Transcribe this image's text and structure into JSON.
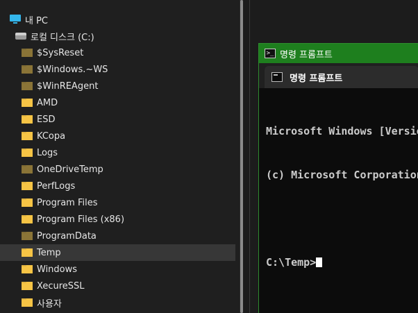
{
  "explorer": {
    "this_pc": "내 PC",
    "drive": "로컬 디스크 (C:)",
    "folders": [
      {
        "label": "$SysReset",
        "style": "dim"
      },
      {
        "label": "$Windows.~WS",
        "style": "dim"
      },
      {
        "label": "$WinREAgent",
        "style": "dim"
      },
      {
        "label": "AMD",
        "style": "normal"
      },
      {
        "label": "ESD",
        "style": "normal"
      },
      {
        "label": "KCopa",
        "style": "normal"
      },
      {
        "label": "Logs",
        "style": "normal"
      },
      {
        "label": "OneDriveTemp",
        "style": "dim"
      },
      {
        "label": "PerfLogs",
        "style": "normal"
      },
      {
        "label": "Program Files",
        "style": "normal"
      },
      {
        "label": "Program Files (x86)",
        "style": "normal"
      },
      {
        "label": "ProgramData",
        "style": "dim"
      },
      {
        "label": "Temp",
        "style": "normal",
        "selected": true
      },
      {
        "label": "Windows",
        "style": "normal"
      },
      {
        "label": "XecureSSL",
        "style": "normal"
      },
      {
        "label": "사용자",
        "style": "normal"
      }
    ]
  },
  "terminal": {
    "window_title": "명령 프롬프트",
    "tab_label": "명령 프롬프트",
    "lines": [
      "Microsoft Windows [Version",
      "(c) Microsoft Corporation",
      "",
      "C:\\Temp>"
    ]
  },
  "colors": {
    "title_bar": "#1e7f1e",
    "folder": "#f6c445",
    "folder_dim": "#8a7437",
    "pc_icon": "#34b6ec"
  }
}
